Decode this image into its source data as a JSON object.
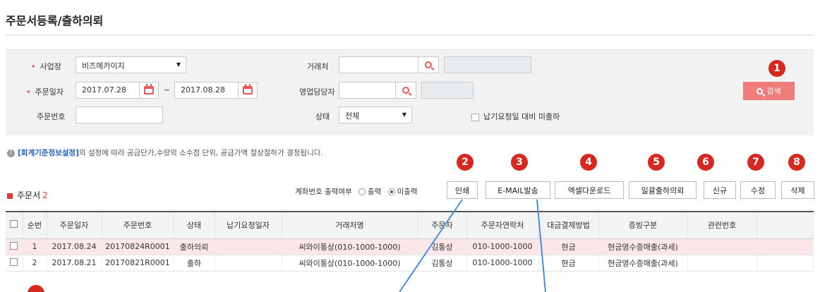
{
  "page": {
    "title": "주문서등록/출하의뢰"
  },
  "search": {
    "workplace_label": "사업장",
    "workplace_value": "비즈메카이지",
    "order_date_label": "주문일자",
    "date_from": "2017.07.28",
    "date_to": "2017.08.28",
    "date_sep": "~",
    "order_no_label": "주문번호",
    "order_no_value": "",
    "client_label": "거래처",
    "sales_rep_label": "영업담당자",
    "status_label": "상태",
    "status_value": "전체",
    "undelivered_label": "납기요청일 대비 미출하",
    "search_button": "검색"
  },
  "notice": {
    "link_text": "[회계기준정보설정]",
    "text": "의 설정에 따라 공급단가,수량의 소수점 단위, 공급가액 절상절하가 결정됩니다."
  },
  "section": {
    "title": "주문서",
    "count": "2"
  },
  "account_print": {
    "label": "계좌번호 출력여부",
    "option_print": "출력",
    "option_noprint": "미출력",
    "selected": "미출력"
  },
  "toolbar": {
    "print": "인쇄",
    "email": "E-MAIL발송",
    "excel": "엑셀다운로드",
    "bulk_ship": "일괄출하의뢰",
    "new": "신규",
    "edit": "수정",
    "delete": "삭제"
  },
  "badges": [
    "1",
    "2",
    "3",
    "4",
    "5",
    "6",
    "7",
    "8"
  ],
  "table": {
    "headers": [
      "순번",
      "주문일자",
      "주문번호",
      "상태",
      "납기요청일자",
      "거래처명",
      "주문자",
      "주문자연락처",
      "대금결제방법",
      "증빙구분",
      "관련번호"
    ],
    "rows": [
      [
        "1",
        "2017.08.24",
        "20170824R0001",
        "출하의뢰",
        "",
        "씨와이통상(010-1000-1000)",
        "김통상",
        "010-1000-1000",
        "현금",
        "현금영수증매출(과세)",
        ""
      ],
      [
        "2",
        "2017.08.21",
        "20170821R0001",
        "출하",
        "",
        "씨와이통상(010-1000-1000)",
        "김통상",
        "010-1000-1000",
        "현금",
        "현금영수증매출(과세)",
        ""
      ]
    ]
  },
  "colors": {
    "accent_red": "#d6281f",
    "search_button": "#ef7b7b",
    "link_blue": "#1f5fbf",
    "selected_row": "#fbe7ea",
    "annotation_line": "#4a8fd6"
  }
}
